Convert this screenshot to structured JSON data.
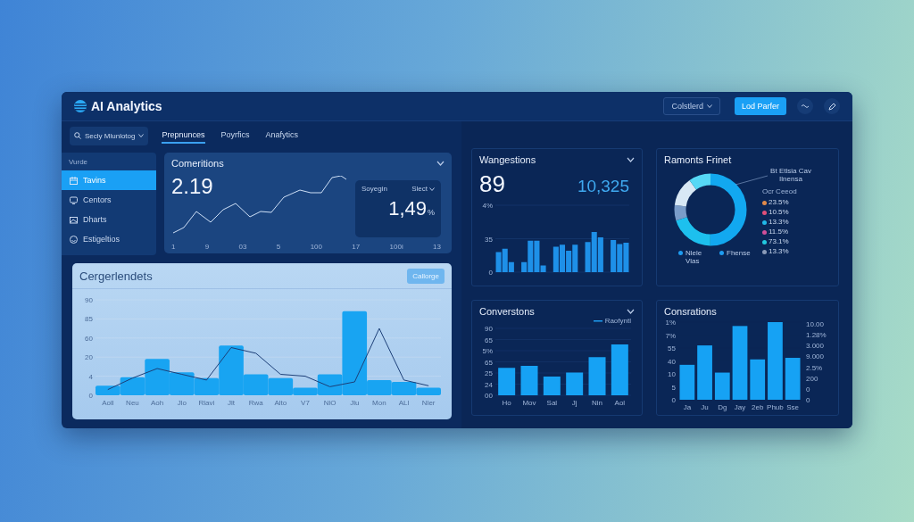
{
  "header": {
    "brand": "AI Analytics",
    "dropdown": "Colstlerd",
    "button": "Lod Parfer"
  },
  "nav": {
    "search": "Secly Mlunlotog",
    "tabs": [
      {
        "label": "Prepnunces",
        "selected": true
      },
      {
        "label": "Poyrfics",
        "selected": false
      },
      {
        "label": "Anafytics",
        "selected": false
      }
    ]
  },
  "sidebar": {
    "heading": "Vurde",
    "items": [
      {
        "label": "Tavins",
        "selected": true
      },
      {
        "label": "Centors",
        "selected": false
      },
      {
        "label": "Dharts",
        "selected": false
      },
      {
        "label": "Estigeltios",
        "selected": false
      }
    ]
  },
  "comeritions": {
    "title": "Comeritions",
    "value": "2.19",
    "x_labels": [
      "1",
      "9",
      "03",
      "5",
      "100",
      "17",
      "100i",
      "13"
    ],
    "inset": {
      "label": "Soyegin",
      "dropdown": "Slect",
      "value": "1,49",
      "unit": "%"
    }
  },
  "cergerlendets": {
    "title": "Cergerlendets",
    "button": "Callorge",
    "y_labels": [
      "90",
      "85",
      "60",
      "20",
      "4",
      "0"
    ],
    "x_labels": [
      "Aoll",
      "Neu",
      "Aoh",
      "Jlo",
      "Rlavi",
      "Jlt",
      "Rwa",
      "Alto",
      "V7",
      "NlO",
      "Jlu",
      "Mon",
      "ALl",
      "Nler"
    ]
  },
  "wangestions": {
    "title": "Wangestions",
    "value": "89",
    "secondary": "10,325",
    "y_labels": [
      "4%",
      "35",
      "0"
    ]
  },
  "ramonts": {
    "title": "Ramonts Frinet",
    "callout": "Bt Etlsia Cav Ilnensa",
    "legend_heading": "Ocr Ceeod",
    "legend": [
      {
        "label": "23.5%",
        "color": "#e08a4a"
      },
      {
        "label": "10.5%",
        "color": "#e0507a"
      },
      {
        "label": "13.3%",
        "color": "#20b8e8"
      },
      {
        "label": "11.5%",
        "color": "#d0509a"
      },
      {
        "label": "73.1%",
        "color": "#22c8e0"
      },
      {
        "label": "13.3%",
        "color": "#8a9ab8"
      }
    ],
    "keys": [
      {
        "label": "Nlele Vlas",
        "color": "#1e9cf0"
      },
      {
        "label": "Fhense",
        "color": "#1e9cf0"
      }
    ]
  },
  "converstons": {
    "title": "Converstons",
    "legend": "Raofyntl",
    "y_labels": [
      "90",
      "65",
      "5%",
      "65",
      "25",
      "24",
      "00"
    ],
    "x_labels": [
      "Ho",
      "Mov",
      "Sal",
      "Jj",
      "Nin",
      "Aol"
    ]
  },
  "consrations": {
    "title": "Consrations",
    "y_labels": [
      "1%",
      "7%",
      "55",
      "40",
      "10",
      "5",
      "0"
    ],
    "right_axis": [
      "10.00",
      "1.28%",
      "3.000",
      "9.000",
      "2.5%",
      "200",
      "0",
      "0"
    ],
    "x_labels": [
      "Ja",
      "Ju",
      "Dg",
      "Jay",
      "2eb",
      "Phub",
      "Sse"
    ]
  }
}
